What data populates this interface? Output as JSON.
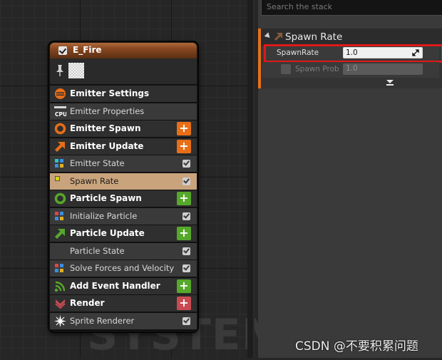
{
  "graph": {
    "watermark": "SYSTEM",
    "node": {
      "title": "E_Fire",
      "enabled": true,
      "rows": [
        {
          "label": "Emitter Settings",
          "kind": "group",
          "icon": "emitter-settings-icon",
          "color": "#e86e17",
          "action": null
        },
        {
          "label": "Emitter Properties",
          "kind": "item",
          "icon": "cpu-icon",
          "color": "#ffffff",
          "action": null
        },
        {
          "label": "Emitter Spawn",
          "kind": "group",
          "icon": "ring-icon",
          "color": "#e86e17",
          "action": "add"
        },
        {
          "label": "Emitter Update",
          "kind": "group",
          "icon": "arrow-up-right-icon",
          "color": "#e86e17",
          "action": "add"
        },
        {
          "label": "Emitter State",
          "kind": "item",
          "icon": "dots-icon",
          "color": "#28c6c6",
          "action": "check"
        },
        {
          "label": "Spawn Rate",
          "kind": "item",
          "icon": "square-icon",
          "color": "#d6d600",
          "action": "check",
          "selected": true
        },
        {
          "label": "Particle Spawn",
          "kind": "group",
          "icon": "ring-icon",
          "color": "#56a82a",
          "action": "add"
        },
        {
          "label": "Initialize Particle",
          "kind": "item",
          "icon": "dots-icon",
          "color": "#e04545",
          "action": "check"
        },
        {
          "label": "Particle Update",
          "kind": "group",
          "icon": "arrow-up-right-icon",
          "color": "#56a82a",
          "action": "add"
        },
        {
          "label": "Particle State",
          "kind": "item",
          "icon": null,
          "color": null,
          "action": "check"
        },
        {
          "label": "Solve Forces and Velocity",
          "kind": "item",
          "icon": "dots-icon",
          "color": "#e04545",
          "action": "check"
        },
        {
          "label": "Add Event Handler",
          "kind": "group",
          "icon": "signal-icon",
          "color": "#56a82a",
          "action": "add"
        },
        {
          "label": "Render",
          "kind": "group",
          "icon": "chevron-down-icon",
          "color": "#c94b52",
          "action": "add"
        },
        {
          "label": "Sprite Renderer",
          "kind": "item",
          "icon": "sparkle-icon",
          "color": "#ffffff",
          "action": "check"
        }
      ]
    }
  },
  "stack": {
    "search_placeholder": "Search the stack",
    "module": {
      "title": "Spawn Rate",
      "accent": "#e4701a",
      "params": [
        {
          "label": "SpawnRate",
          "value": "1.0",
          "enabled": true
        },
        {
          "label": "Spawn Prob",
          "value": "1.0",
          "enabled": false
        }
      ]
    }
  },
  "watermark": "CSDN @不要积累问题",
  "colors": {
    "highlight": "#e01818",
    "selected_row": "#c9a37c"
  }
}
